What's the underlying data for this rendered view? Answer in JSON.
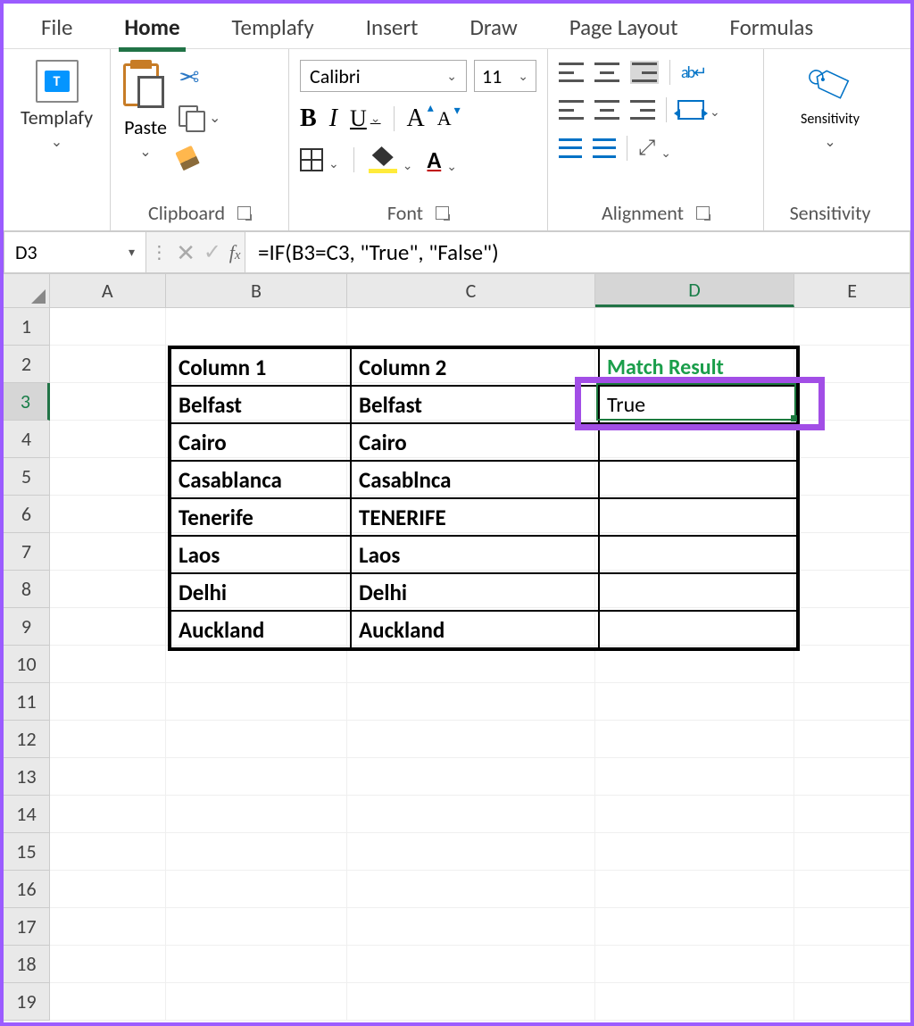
{
  "tabs": {
    "file": "File",
    "home": "Home",
    "templafy": "Templafy",
    "insert": "Insert",
    "draw": "Draw",
    "page_layout": "Page Layout",
    "formulas": "Formulas"
  },
  "ribbon": {
    "templafy": {
      "label": "Templafy",
      "icon_letter": "T"
    },
    "clipboard": {
      "label": "Clipboard",
      "paste": "Paste"
    },
    "font": {
      "label": "Font",
      "name": "Calibri",
      "size": "11",
      "bold": "B",
      "italic": "I",
      "underline": "U",
      "grow": "A",
      "shrink": "A",
      "fontcolor_letter": "A"
    },
    "alignment": {
      "label": "Alignment",
      "wrap": "ab"
    },
    "sensitivity": {
      "label": "Sensitivity",
      "button": "Sensitivity"
    }
  },
  "formula_bar": {
    "cell_ref": "D3",
    "fx": "fx",
    "formula": "=IF(B3=C3, \"True\", \"False\")"
  },
  "columns": [
    "A",
    "B",
    "C",
    "D",
    "E"
  ],
  "row_headers": [
    "1",
    "2",
    "3",
    "4",
    "5",
    "6",
    "7",
    "8",
    "9",
    "10",
    "11",
    "12",
    "13",
    "14",
    "15",
    "16",
    "17",
    "18",
    "19"
  ],
  "table": {
    "headers": {
      "col1": "Column 1",
      "col2": "Column 2",
      "result": "Match Result"
    },
    "rows": [
      {
        "c1": "Belfast",
        "c2": "Belfast",
        "r": "True"
      },
      {
        "c1": "Cairo",
        "c2": "Cairo",
        "r": ""
      },
      {
        "c1": "Casablanca",
        "c2": "Casablnca",
        "r": ""
      },
      {
        "c1": "Tenerife",
        "c2": "TENERIFE",
        "r": ""
      },
      {
        "c1": "Laos",
        "c2": "Laos",
        "r": ""
      },
      {
        "c1": "Delhi",
        "c2": "Delhi",
        "r": ""
      },
      {
        "c1": "Auckland",
        "c2": "Auckland",
        "r": ""
      }
    ]
  }
}
